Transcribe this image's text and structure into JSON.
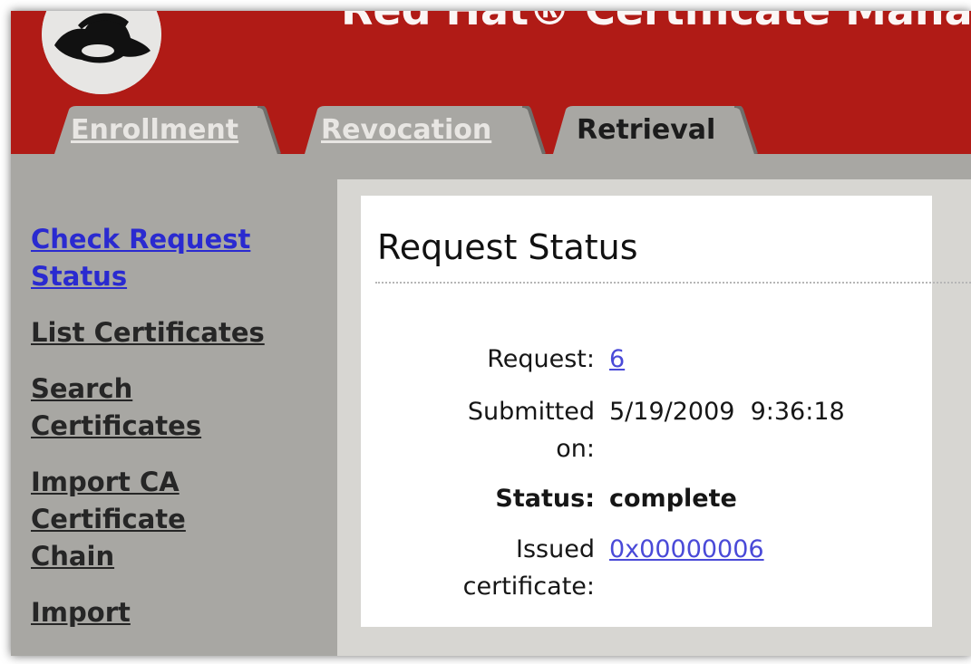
{
  "header": {
    "title": "Red Hat® Certificate Manag",
    "logo": "red-hat-shadowman-logo"
  },
  "tabs": [
    {
      "label": "Enrollment",
      "active": false
    },
    {
      "label": "Revocation",
      "active": false
    },
    {
      "label": "Retrieval",
      "active": true
    }
  ],
  "sidebar": {
    "items": [
      {
        "label": "Check Request Status",
        "current": true
      },
      {
        "label": "List Certificates"
      },
      {
        "label": "Search Certificates"
      },
      {
        "label": "Import CA Certificate Chain"
      },
      {
        "label": "Import"
      }
    ]
  },
  "main": {
    "title": "Request Status",
    "fields": {
      "request_label": "Request:",
      "request_value": "6",
      "submitted_label": "Submitted on:",
      "submitted_value": "5/19/2009  9:36:18",
      "status_label": "Status:",
      "status_value": "complete",
      "issued_label": "Issued certificate:",
      "issued_value": "0x00000006"
    }
  },
  "colors": {
    "header_red": "#b01b16",
    "sidebar_gray": "#a8a7a3",
    "link_blue": "#2a2ad0",
    "value_link": "#4a4ad8"
  }
}
